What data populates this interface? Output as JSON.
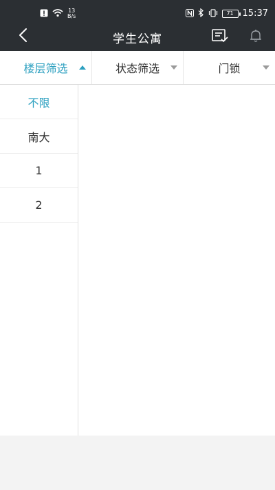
{
  "statusbar": {
    "net_speed_value": "13",
    "net_speed_unit": "B/s",
    "battery": "71",
    "time": "15:37",
    "icons": [
      "alert-icon",
      "wifi-icon",
      "nfc-icon",
      "bluetooth-icon",
      "vibrate-icon",
      "battery-icon"
    ]
  },
  "appbar": {
    "title": "学生公寓",
    "icons": [
      "back-arrow-icon",
      "list-check-icon",
      "bell-icon"
    ]
  },
  "filters": [
    {
      "label": "楼层筛选",
      "active": true,
      "caret": "up"
    },
    {
      "label": "状态筛选",
      "active": false,
      "caret": "down"
    },
    {
      "label": "门锁",
      "active": false,
      "caret": "down"
    }
  ],
  "floor_list": {
    "items": [
      {
        "label": "不限",
        "selected": true
      },
      {
        "label": "南大",
        "selected": false
      },
      {
        "label": "1",
        "selected": false
      },
      {
        "label": "2",
        "selected": false
      }
    ]
  },
  "colors": {
    "header_bg": "#2b2f33",
    "accent": "#2da0c0",
    "page_bg": "#f3f3f3"
  }
}
